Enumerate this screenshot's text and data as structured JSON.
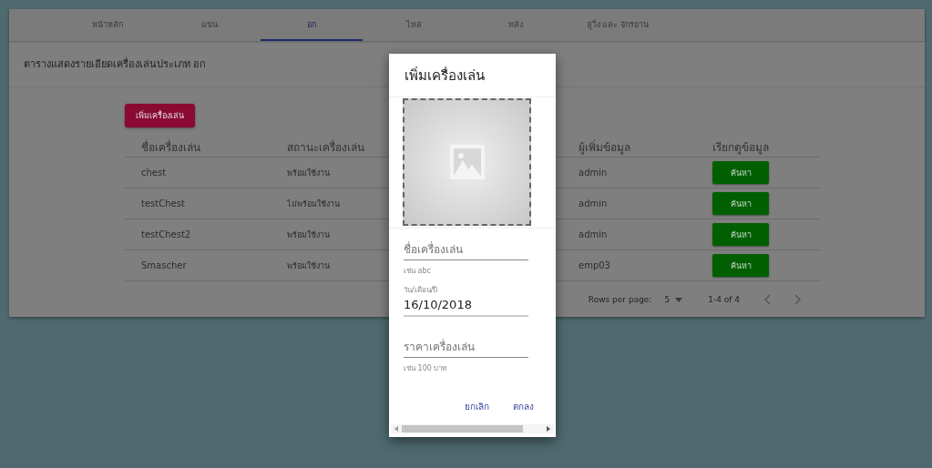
{
  "tabs": [
    {
      "label": "หน้าหลัก",
      "selected": false
    },
    {
      "label": "แขน",
      "selected": false
    },
    {
      "label": "อก",
      "selected": true
    },
    {
      "label": "ไหล่",
      "selected": false
    },
    {
      "label": "หลัง",
      "selected": false
    },
    {
      "label": "ลู่วิ่ง และ จักรยาน",
      "selected": false
    }
  ],
  "page_title": "ตารางแสดงรายเอียดเครื่องเล่นประเภท อก",
  "add_button": "เพิ่มเครื่องเล่น",
  "table": {
    "columns": [
      "ชื่อเครื่องเล่น",
      "สถานะเครื่องเล่น",
      "ผู้เพิ่มข้อมูล",
      "เรียกดูข้อมูล"
    ],
    "rows": [
      {
        "name": "chest",
        "status": "พร้อมใช้งาน",
        "added_by": "admin",
        "action": "ค้นหา"
      },
      {
        "name": "testChest",
        "status": "ไม่พร้อมใช้งาน",
        "added_by": "admin",
        "action": "ค้นหา"
      },
      {
        "name": "testChest2",
        "status": "พร้อมใช้งาน",
        "added_by": "admin",
        "action": "ค้นหา"
      },
      {
        "name": "Smascher",
        "status": "พร้อมใช้งาน",
        "added_by": "emp03",
        "action": "ค้นหา"
      }
    ]
  },
  "pagination": {
    "rows_per_page_label": "Rows per page:",
    "rows_per_page": "5",
    "range": "1-4 of 4"
  },
  "dialog": {
    "title": "เพิ่มเครื่องเล่น",
    "name_field": {
      "placeholder": "ชื่อเครื่องเล่น",
      "hint": "เช่น abc"
    },
    "date_field": {
      "label": "วัน/เดือน/ปี",
      "value": "16/10/2018"
    },
    "price_field": {
      "placeholder": "ราคาเครื่องเล่น",
      "hint": "เช่น 100 บาท"
    },
    "buttons": [
      "ยกเลิก",
      "ตกลง"
    ]
  }
}
